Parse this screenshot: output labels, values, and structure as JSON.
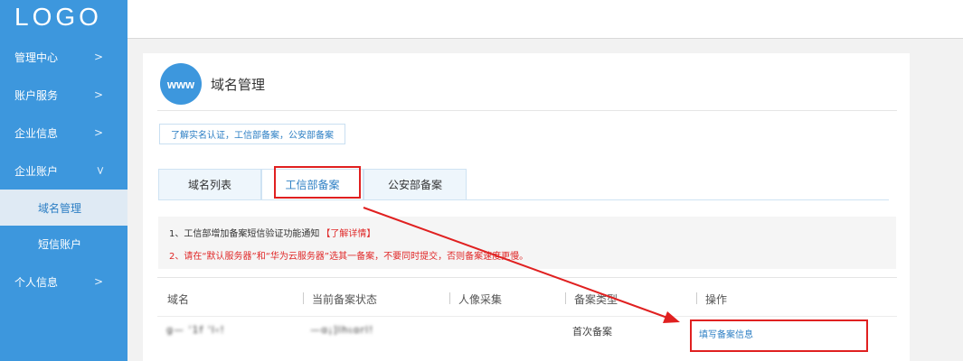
{
  "sidebar": {
    "logo": "LOGO",
    "items": [
      {
        "label": "管理中心"
      },
      {
        "label": "账户服务"
      },
      {
        "label": "企业信息"
      },
      {
        "label": "企业账户"
      }
    ],
    "sub_items": [
      {
        "label": "域名管理",
        "active": true
      },
      {
        "label": "短信账户",
        "active": false
      }
    ],
    "last_item": {
      "label": "个人信息"
    }
  },
  "header": {
    "icon_text": "www",
    "title": "域名管理"
  },
  "notice_button": "了解实名认证，工信部备案，公安部备案",
  "tabs": [
    {
      "label": "域名列表"
    },
    {
      "label": "工信部备案"
    },
    {
      "label": "公安部备案"
    }
  ],
  "info": {
    "line1": "1、工信部增加备案短信验证功能通知",
    "line1_link": "【了解详情】",
    "line2": "2、请在“默认服务器”和“华为云服务器”选其一备案，不要同时提交，否则备案速度更慢。"
  },
  "table": {
    "columns": [
      "域名",
      "当前备案状态",
      "人像采集",
      "备案类型",
      "操作"
    ],
    "rows": [
      {
        "domain": "g— '1f 'l‹!",
        "status": "—ɑ¡]lhιɑrl!",
        "face": "",
        "type": "首次备案",
        "action": "填写备案信息"
      }
    ]
  },
  "colors": {
    "sidebar": "#3d97dd",
    "accent": "#2d7fc4",
    "annotation": "#e02020"
  }
}
